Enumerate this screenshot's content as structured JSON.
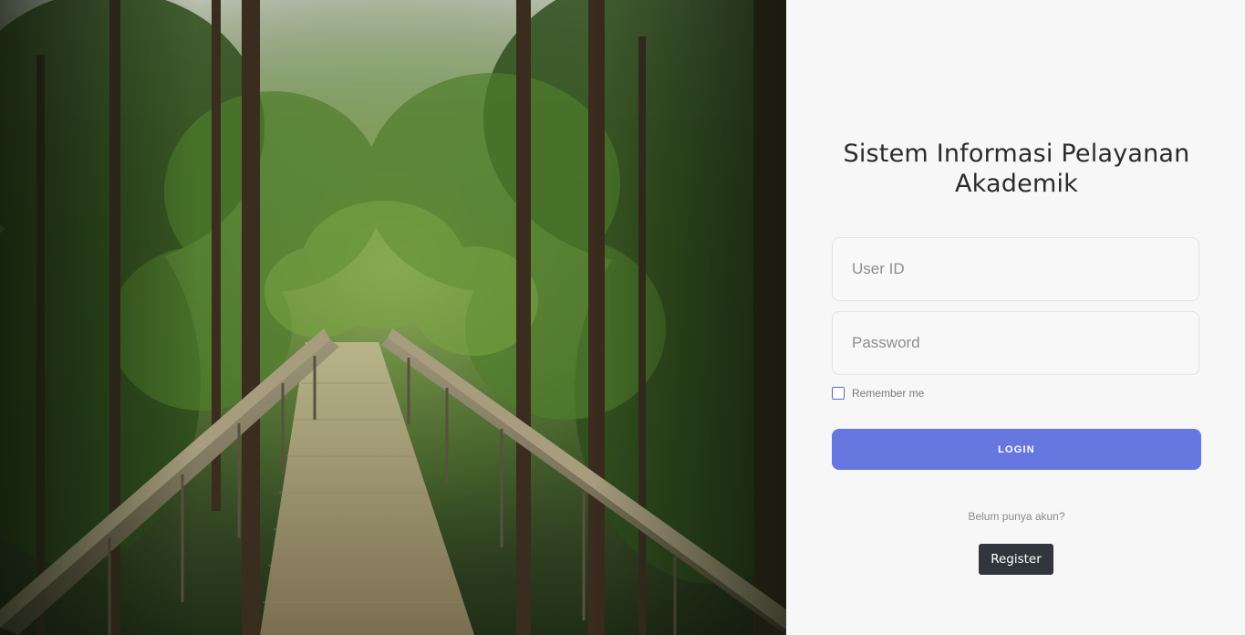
{
  "app": {
    "title": "Sistem Informasi Pelayanan Akademik"
  },
  "hero": {
    "image": "forest-bridge-photo"
  },
  "form": {
    "user_id": {
      "value": "",
      "placeholder": "User ID"
    },
    "password": {
      "value": "",
      "placeholder": "Password"
    },
    "remember_label": "Remember me",
    "remember_checked": false,
    "login_label": "LOGIN"
  },
  "footer": {
    "prompt": "Belum punya akun?",
    "register_label": "Register"
  },
  "colors": {
    "accent": "#6777e0",
    "register_bg": "#31363c",
    "panel_bg": "#f7f7f7"
  }
}
